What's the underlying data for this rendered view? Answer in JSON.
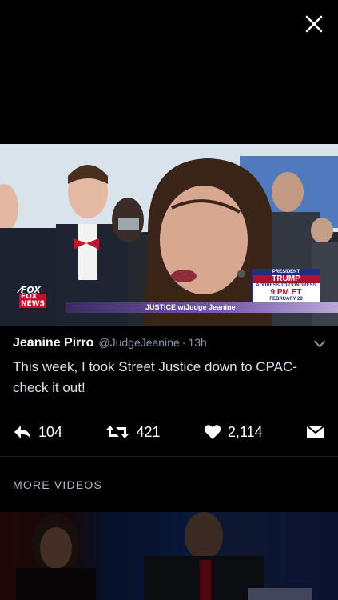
{
  "close": {
    "icon": "close-icon"
  },
  "video": {
    "fox_logo": "FOX NEWS",
    "ticker_text": "JUSTICE w/Judge Jeanine",
    "promo": {
      "line1": "PRESIDENT",
      "line2": "TRUMP",
      "line3": "ADDRESS TO CONGRESS",
      "line4": "9 PM ET",
      "line5": "FEBRUARY 28"
    }
  },
  "tweet": {
    "author": "Jeanine Pirro",
    "handle": "@JudgeJeanine",
    "separator": "·",
    "time": "13h",
    "text": "This week, I took Street Justice down to CPAC- check it out!"
  },
  "actions": {
    "reply_count": "104",
    "retweet_count": "421",
    "like_count": "2,114"
  },
  "section": {
    "more_videos": "MORE VIDEOS"
  },
  "colors": {
    "background": "#000000",
    "muted": "#8899a6",
    "text": "#d9e1e8"
  }
}
